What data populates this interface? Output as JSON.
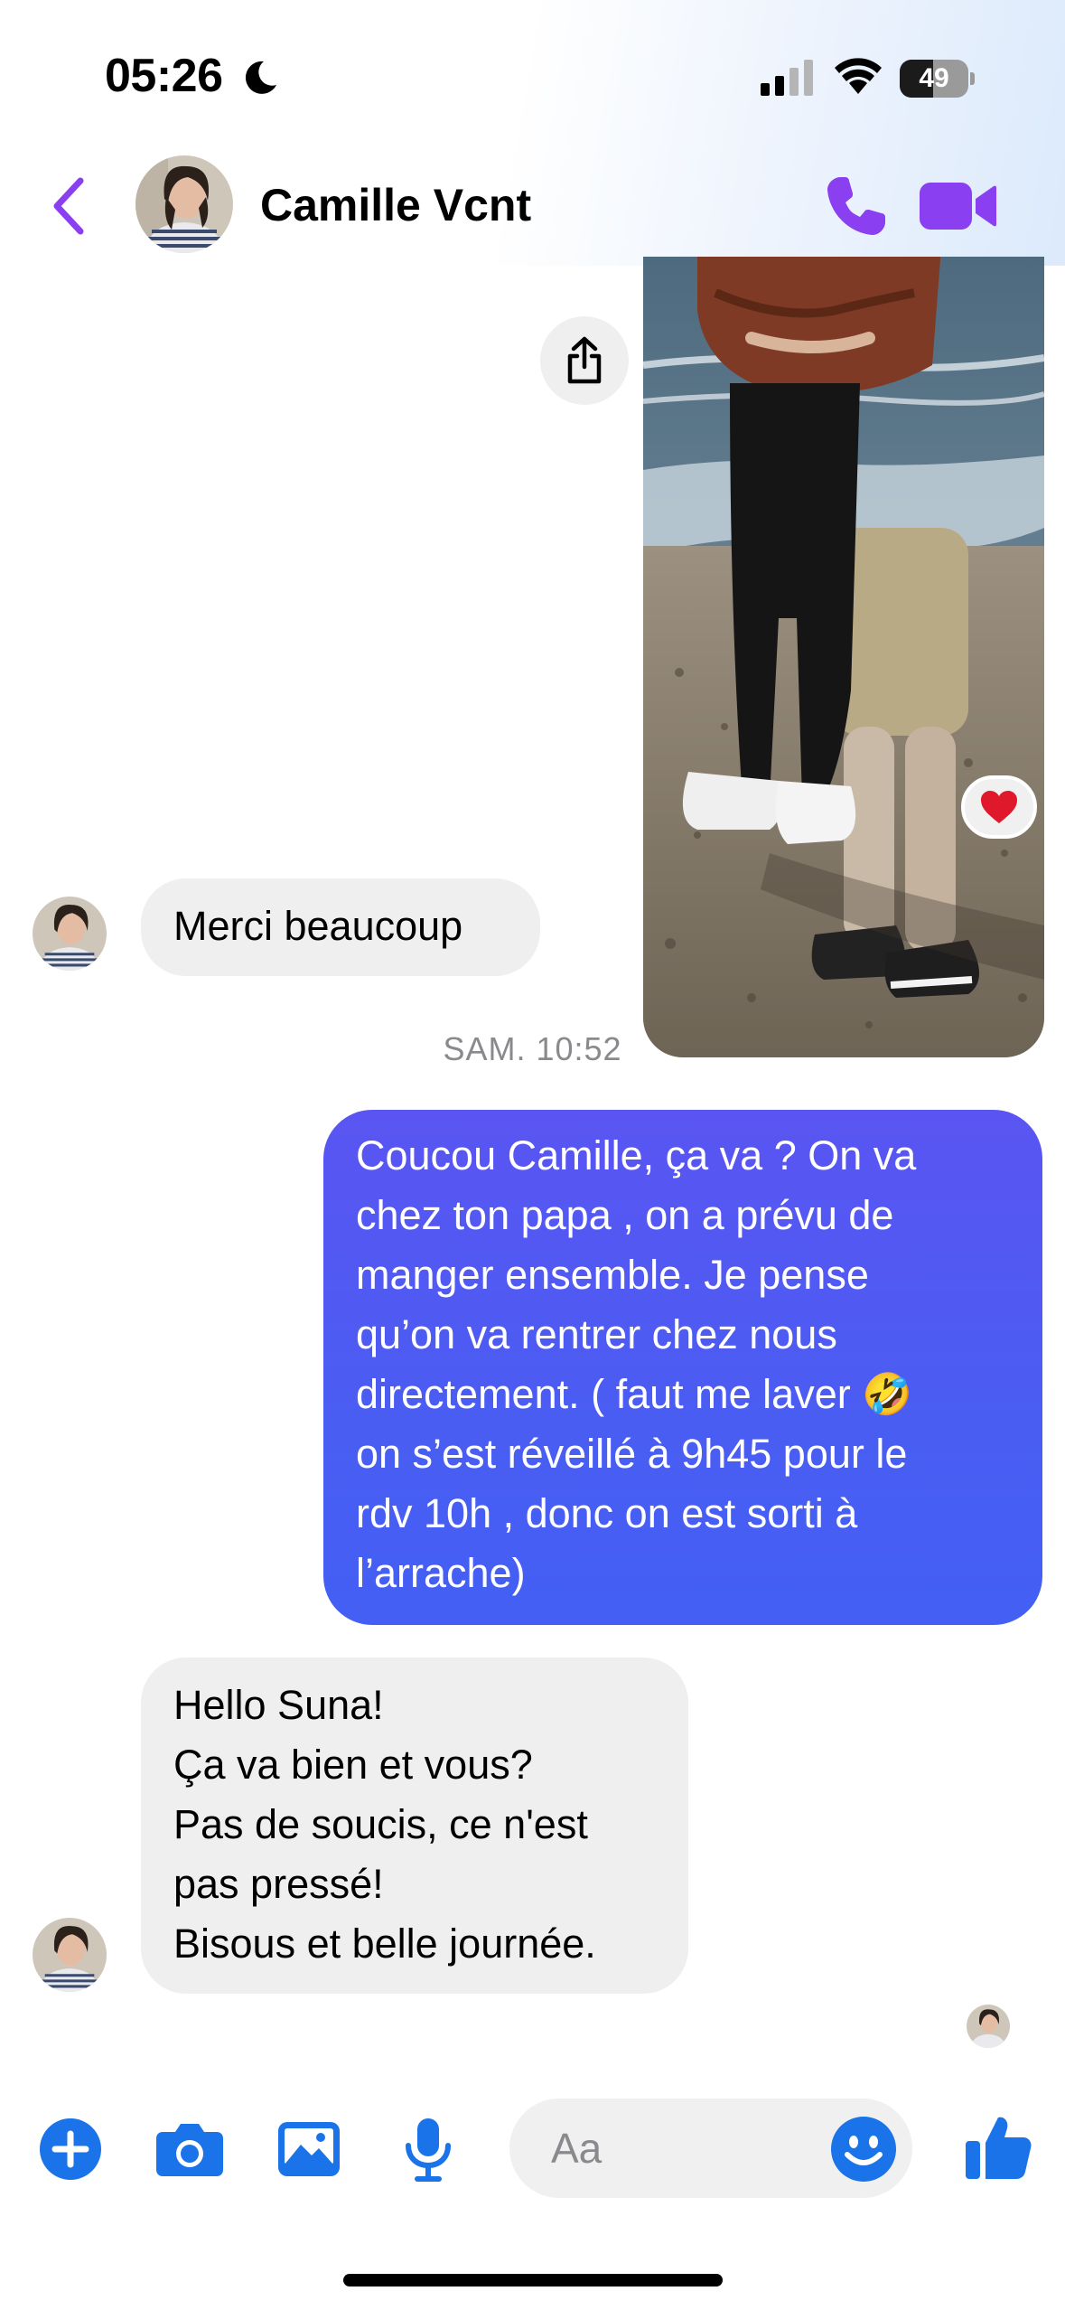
{
  "status_bar": {
    "time": "05:26",
    "battery_percent": "49",
    "battery_level": 0.49
  },
  "header": {
    "contact_name": "Camille Vcnt"
  },
  "colors": {
    "accent": "#8a3ff0",
    "outgoing_bubble": "#4f5af3",
    "incoming_bubble": "#efefef",
    "composer_icons": "#1a73e8"
  },
  "messages": [
    {
      "type": "image",
      "direction": "outgoing",
      "reaction": "❤️"
    },
    {
      "type": "text",
      "direction": "incoming",
      "text": "Merci beaucoup"
    },
    {
      "type": "timestamp",
      "text": "SAM. 10:52"
    },
    {
      "type": "text",
      "direction": "outgoing",
      "text": "Coucou Camille, ça va ? On va\nchez ton papa , on a prévu de\nmanger ensemble. Je pense\nqu’on va rentrer chez nous\ndirectement. ( faut me laver 🤣\non s’est réveillé à 9h45 pour le\nrdv 10h , donc on est sorti à\nl’arrache)"
    },
    {
      "type": "text",
      "direction": "incoming",
      "text": "Hello Suna!\nÇa va bien et vous?\nPas de soucis, ce n'est\npas pressé!\nBisous et belle journée."
    }
  ],
  "composer": {
    "placeholder": "Aa",
    "value": ""
  },
  "icons": {
    "back": "chevron-left-icon",
    "call": "phone-icon",
    "video": "video-camera-icon",
    "share": "share-icon",
    "plus": "plus-circle-icon",
    "camera": "camera-icon",
    "gallery": "image-icon",
    "mic": "microphone-icon",
    "emoji": "emoji-icon",
    "like": "thumbs-up-icon"
  }
}
